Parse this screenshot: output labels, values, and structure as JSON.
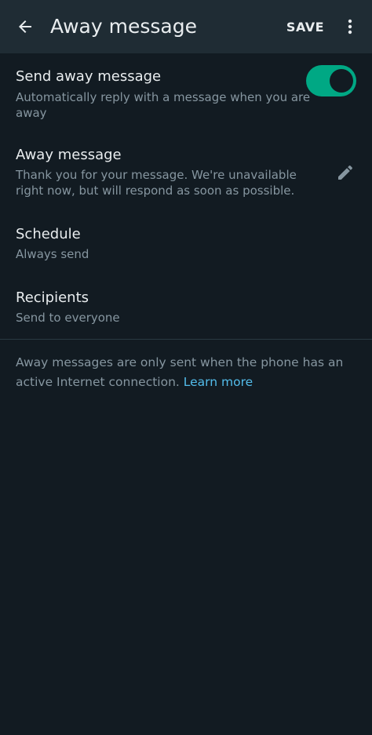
{
  "appbar": {
    "title": "Away message",
    "save_label": "SAVE",
    "back_icon": "arrow-left-icon",
    "more_icon": "more-vertical-icon"
  },
  "send_away": {
    "title": "Send away message",
    "subtitle": "Automatically reply with a message when you are away",
    "toggle_on": true
  },
  "away_message": {
    "title": "Away message",
    "text": "Thank you for your message. We're unavailable right now, but will respond as soon as possible.",
    "edit_icon": "pencil-icon"
  },
  "schedule": {
    "title": "Schedule",
    "value": "Always send"
  },
  "recipients": {
    "title": "Recipients",
    "value": "Send to everyone"
  },
  "footer": {
    "note": "Away messages are only sent when the phone has an active Internet connection.",
    "link": "Learn more"
  },
  "colors": {
    "background": "#121b22",
    "appbar": "#1f2c34",
    "accent": "#00a884",
    "link": "#53bdeb",
    "secondary_text": "#8696a0"
  }
}
